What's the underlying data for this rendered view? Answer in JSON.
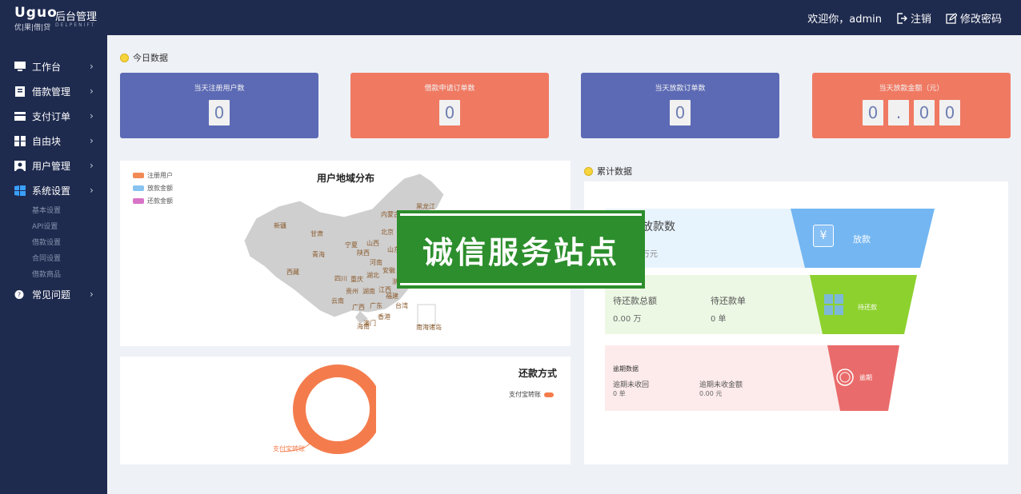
{
  "header": {
    "logo_mark": "Uguo",
    "logo_sub": "优|果|借|贷",
    "app_title": "后台管理",
    "logo_en": "DELPENIFT",
    "welcome": "欢迎你，admin",
    "logout": "注销",
    "change_password": "修改密码"
  },
  "sidebar": {
    "items": [
      {
        "label": "工作台",
        "icon": "monitor-icon"
      },
      {
        "label": "借款管理",
        "icon": "document-icon"
      },
      {
        "label": "支付订单",
        "icon": "card-icon"
      },
      {
        "label": "自由块",
        "icon": "grid-icon"
      },
      {
        "label": "用户管理",
        "icon": "user-icon"
      },
      {
        "label": "系统设置",
        "icon": "windows-icon"
      }
    ],
    "sub_items": [
      "基本设置",
      "API设置",
      "借款设置",
      "合同设置",
      "借款商品"
    ],
    "faq": "常见问题"
  },
  "today": {
    "title": "今日数据",
    "cards": [
      {
        "label": "当天注册用户数",
        "digits": [
          "0"
        ],
        "color": "#5c6ab5"
      },
      {
        "label": "借款申请订单数",
        "digits": [
          "0"
        ],
        "color": "#f07962"
      },
      {
        "label": "当天放款订单数",
        "digits": [
          "0"
        ],
        "color": "#5c6ab5"
      },
      {
        "label": "当天放款金额（元）",
        "digits": [
          "0",
          ".",
          "0",
          "0"
        ],
        "color": "#f07962"
      }
    ]
  },
  "map": {
    "title": "用户地域分布",
    "legend": [
      {
        "label": "注册用户",
        "color": "#f28a57"
      },
      {
        "label": "放款金额",
        "color": "#88c3f0"
      },
      {
        "label": "还款金额",
        "color": "#d873c7"
      }
    ],
    "provinces": [
      "新疆",
      "西藏",
      "甘肃",
      "青海",
      "内蒙古",
      "黑龙江",
      "北京",
      "宁夏",
      "山西",
      "陕西",
      "河南",
      "四川",
      "重庆",
      "湖北",
      "贵州",
      "湖南",
      "江西",
      "云南",
      "广西",
      "广东",
      "福建",
      "澳门",
      "香港",
      "海南",
      "安徽",
      "浙江",
      "山东",
      "台湾",
      "南海诸岛"
    ]
  },
  "repay": {
    "title": "还款方式",
    "legend_label": "支付宝转账",
    "callout_label": "支付宝转账",
    "ring_color": "#f47c4c"
  },
  "cumulative": {
    "title": "累计数据",
    "rows": [
      {
        "left_title": "放款数",
        "left_value": "万元",
        "tag": "放款",
        "bg": "#e8f4fd",
        "funnel_color": "#73b6f2",
        "icon": "receipt-icon"
      },
      {
        "cols": [
          {
            "label": "待还款总额",
            "value": "0.00 万"
          },
          {
            "label": "待还款单",
            "value": "0 单"
          }
        ],
        "tag": "待还款",
        "bg": "#ecf8e4",
        "funnel_color": "#8dd12e",
        "icon": "calendar-icon"
      },
      {
        "caption": "逾期数据",
        "cols": [
          {
            "label": "逾期未收回",
            "value": "0 单"
          },
          {
            "label": "逾期未收金额",
            "value": "0.00 元"
          }
        ],
        "tag": "逾期",
        "bg": "#fdebeb",
        "funnel_color": "#ea6b6b",
        "icon": "stamp-icon"
      }
    ]
  },
  "watermark": "诚信服务站点"
}
